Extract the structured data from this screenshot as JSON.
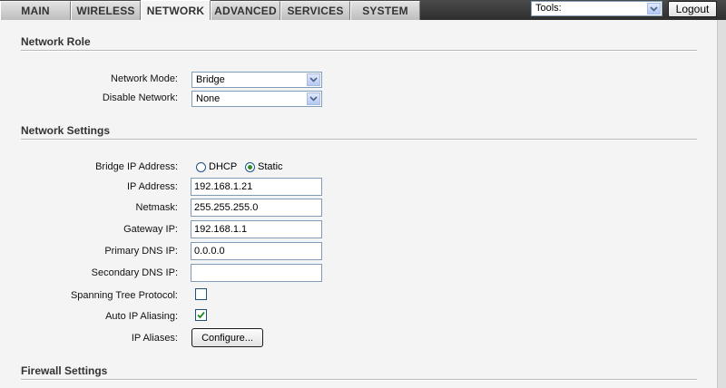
{
  "tabs": [
    {
      "label": "MAIN"
    },
    {
      "label": "WIRELESS"
    },
    {
      "label": "NETWORK"
    },
    {
      "label": "ADVANCED"
    },
    {
      "label": "SERVICES"
    },
    {
      "label": "SYSTEM"
    }
  ],
  "active_tab": "NETWORK",
  "toolbar": {
    "tools_value": "Tools:",
    "logout_label": "Logout"
  },
  "network_role": {
    "title": "Network Role",
    "mode_label": "Network Mode:",
    "mode_value": "Bridge",
    "disable_label": "Disable Network:",
    "disable_value": "None"
  },
  "network_settings": {
    "title": "Network Settings",
    "bridge_ip_label": "Bridge IP Address:",
    "dhcp_label": "DHCP",
    "static_label": "Static",
    "selected_mode": "Static",
    "ip_label": "IP Address:",
    "ip_value": "192.168.1.21",
    "netmask_label": "Netmask:",
    "netmask_value": "255.255.255.0",
    "gateway_label": "Gateway IP:",
    "gateway_value": "192.168.1.1",
    "primary_dns_label": "Primary DNS IP:",
    "primary_dns_value": "0.0.0.0",
    "secondary_dns_label": "Secondary DNS IP:",
    "secondary_dns_value": "",
    "stp_label": "Spanning Tree Protocol:",
    "stp_checked": false,
    "auto_alias_label": "Auto IP Aliasing:",
    "auto_alias_checked": true,
    "ip_aliases_label": "IP Aliases:",
    "configure_label": "Configure..."
  },
  "firewall": {
    "title": "Firewall Settings"
  },
  "colors": {
    "radio_selected": "#2a8f2a",
    "checkmark": "#1e8a1e",
    "control_border": "#7f9db9"
  }
}
